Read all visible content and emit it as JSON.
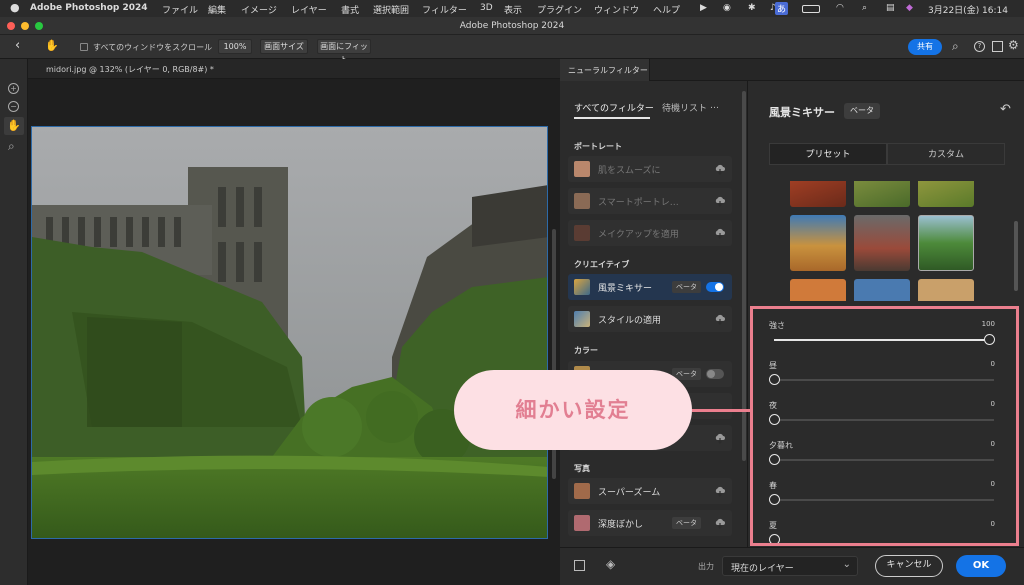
{
  "menubar": {
    "app_name": "Adobe Photoshop 2024",
    "items": [
      "ファイル",
      "編集",
      "イメージ",
      "レイヤー",
      "書式",
      "選択範囲",
      "フィルター",
      "3D",
      "表示",
      "プラグイン",
      "ウィンドウ",
      "ヘルプ"
    ],
    "ime": "あ",
    "clock": "3月22日(金)  16:14"
  },
  "window": {
    "title": "Adobe Photoshop 2024"
  },
  "options": {
    "scroll_all_label": "すべてのウィンドウをスクロール",
    "zoom": "100%",
    "fit_screen_size": "画面サイズ",
    "fit_screen": "画面にフィット",
    "share": "共有"
  },
  "document": {
    "tab_title": "midori.jpg @ 132% (レイヤー 0, RGB/8#) *"
  },
  "neural": {
    "panel_tab": "ニューラルフィルター",
    "tab_all": "すべてのフィルター",
    "tab_waitlist": "待機リスト",
    "sections": {
      "portrait": "ポートレート",
      "creative": "クリエイティブ",
      "color": "カラー",
      "photo": "写真"
    },
    "filters": {
      "skin": "肌をスムーズに",
      "smart_portrait": "スマートポートレ…",
      "makeup": "メイクアップを適用",
      "landscape": "風景ミキサー",
      "style": "スタイルの適用",
      "superzoom": "スーパーズーム",
      "depth": "深度ぼかし"
    },
    "beta_label": "ベータ",
    "settings_title": "風景ミキサー",
    "preset_tab": "プリセット",
    "custom_tab": "カスタム",
    "sliders": [
      {
        "label": "強さ",
        "value": "100"
      },
      {
        "label": "昼",
        "value": "0"
      },
      {
        "label": "夜",
        "value": "0"
      },
      {
        "label": "夕暮れ",
        "value": "0"
      },
      {
        "label": "春",
        "value": "0"
      },
      {
        "label": "夏",
        "value": "0"
      }
    ],
    "output_label": "出力",
    "output_value": "現在のレイヤー",
    "cancel": "キャンセル",
    "ok": "OK"
  },
  "annotation": {
    "text": "細かい設定"
  },
  "colors": {
    "accent": "#1473e6",
    "highlight": "#eb7f8e",
    "callout_bg": "#fde0e4"
  }
}
